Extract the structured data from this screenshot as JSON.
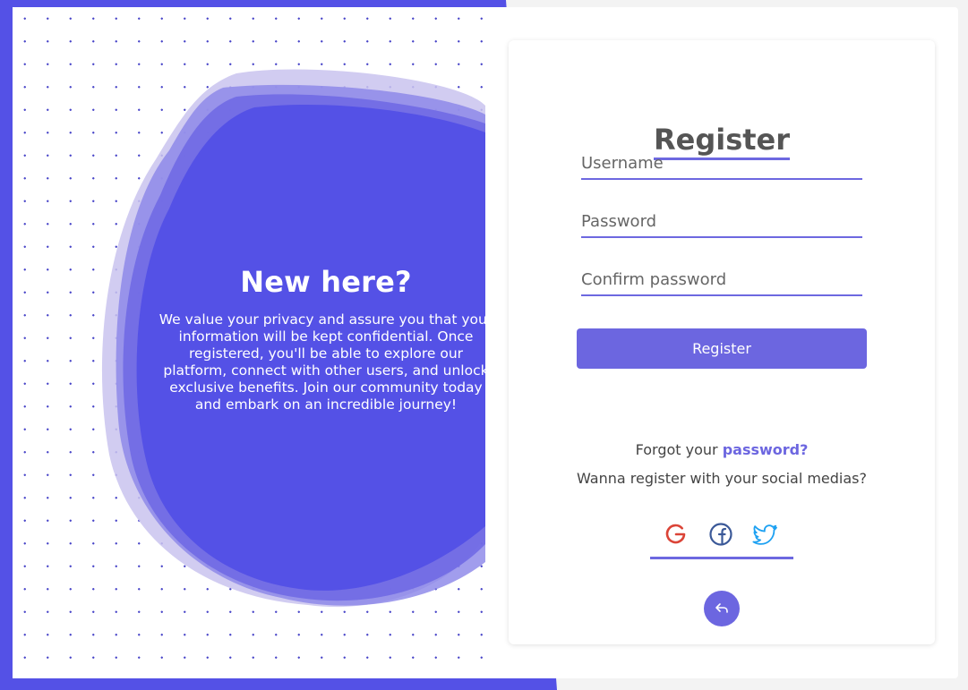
{
  "promo": {
    "title": "New here?",
    "text": "We value your privacy and assure you that your information will be kept confidential. Once registered, you'll be able to explore our platform, connect with other users, and unlock exclusive benefits. Join our community today and embark on an incredible journey!"
  },
  "form": {
    "title": "Register",
    "username_placeholder": "Username",
    "password_placeholder": "Password",
    "confirm_placeholder": "Confirm password",
    "submit_label": "Register",
    "forgot_prefix": "Forgot your ",
    "forgot_link": "password?",
    "social_prompt": "Wanna register with your social medias?"
  },
  "social": {
    "icons": [
      "google-icon",
      "facebook-icon",
      "twitter-icon"
    ]
  },
  "colors": {
    "accent": "#6c66e0",
    "brand_blue": "#5451e6",
    "google": "#db4437",
    "facebook": "#3b5998",
    "twitter": "#1da1f2"
  }
}
